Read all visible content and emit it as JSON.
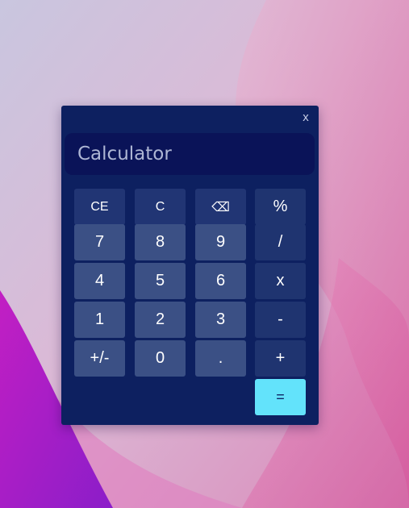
{
  "window": {
    "close_label": "x"
  },
  "display": {
    "placeholder": "Calculator"
  },
  "keys": [
    {
      "label": "CE",
      "kind": "func"
    },
    {
      "label": "C",
      "kind": "func"
    },
    {
      "label": "⌫",
      "kind": "func",
      "icon": "backspace-icon"
    },
    {
      "label": "%",
      "kind": "op"
    },
    {
      "label": "7",
      "kind": "digit"
    },
    {
      "label": "8",
      "kind": "digit"
    },
    {
      "label": "9",
      "kind": "digit"
    },
    {
      "label": "/",
      "kind": "op"
    },
    {
      "label": "4",
      "kind": "digit"
    },
    {
      "label": "5",
      "kind": "digit"
    },
    {
      "label": "6",
      "kind": "digit"
    },
    {
      "label": "x",
      "kind": "op"
    },
    {
      "label": "1",
      "kind": "digit"
    },
    {
      "label": "2",
      "kind": "digit"
    },
    {
      "label": "3",
      "kind": "digit"
    },
    {
      "label": "-",
      "kind": "op"
    },
    {
      "label": "+/-",
      "kind": "digit"
    },
    {
      "label": "0",
      "kind": "digit"
    },
    {
      "label": ".",
      "kind": "digit"
    },
    {
      "label": "+",
      "kind": "op"
    },
    {
      "label": "=",
      "kind": "eq"
    }
  ],
  "colors": {
    "window_bg": "#0d2060",
    "display_bg": "#0a1358",
    "digit_key": "#3b5085",
    "func_key": "#213574",
    "operator_key": "#1f3470",
    "equals_key": "#63e3fb"
  }
}
